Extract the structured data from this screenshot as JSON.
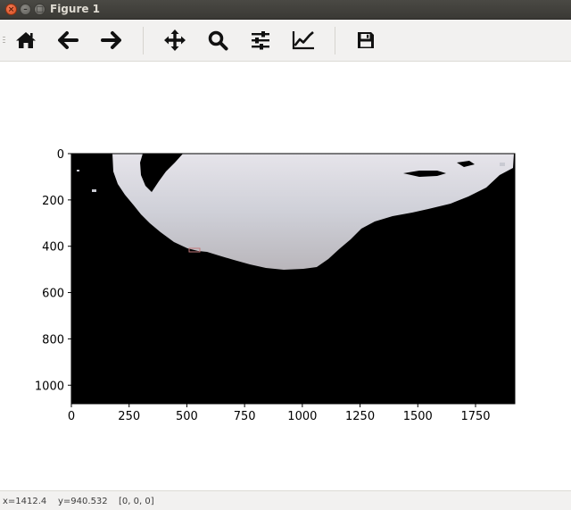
{
  "window": {
    "title": "Figure 1",
    "close_glyph": "×",
    "minimize_glyph": "–",
    "maximize_glyph": "□"
  },
  "toolbar": {
    "buttons": [
      {
        "name": "home",
        "icon": "home-icon",
        "tooltip": "Reset original view"
      },
      {
        "name": "back",
        "icon": "arrow-left-icon",
        "tooltip": "Back to previous view"
      },
      {
        "name": "forward",
        "icon": "arrow-right-icon",
        "tooltip": "Forward to next view"
      },
      {
        "name": "pan",
        "icon": "move-arrows-icon",
        "tooltip": "Pan axes"
      },
      {
        "name": "zoom",
        "icon": "magnifier-icon",
        "tooltip": "Zoom to rectangle"
      },
      {
        "name": "configure",
        "icon": "sliders-icon",
        "tooltip": "Configure subplots"
      },
      {
        "name": "edit",
        "icon": "line-chart-icon",
        "tooltip": "Edit axis, curve and image parameters"
      },
      {
        "name": "save",
        "icon": "floppy-disk-icon",
        "tooltip": "Save the figure"
      }
    ]
  },
  "chart_data": {
    "type": "image",
    "description_of_content": "masked sky photograph; non-sky regions are black",
    "xlim": [
      0,
      1920
    ],
    "ylim": [
      1080,
      0
    ],
    "xticks": [
      0,
      250,
      500,
      750,
      1000,
      1250,
      1500,
      1750
    ],
    "yticks": [
      0,
      200,
      400,
      600,
      800,
      1000
    ],
    "xtick_labels": [
      "0",
      "250",
      "500",
      "750",
      "1000",
      "1250",
      "1500",
      "1750"
    ],
    "ytick_labels": [
      "0",
      "200",
      "400",
      "600",
      "800",
      "1000"
    ],
    "background_color": "#000000",
    "sky_color": "#d4d5dc",
    "title": "",
    "xlabel": "",
    "ylabel": ""
  },
  "status": {
    "x": "x=1412.4",
    "y": "y=940.532",
    "value": "[0, 0, 0]"
  }
}
